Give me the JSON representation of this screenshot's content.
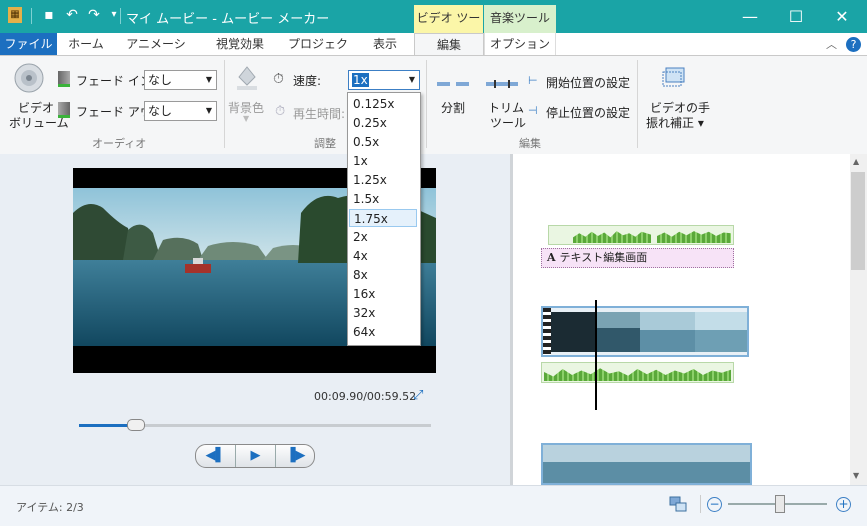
{
  "window": {
    "title": "マイ ムービー - ムービー メーカー",
    "minimize": "—",
    "maximize": "☐",
    "close": "✕"
  },
  "context_tabs": {
    "video_tools": "ビデオ ツール",
    "music_tools": "音楽ツール"
  },
  "tabs": [
    "ファイル",
    "ホーム",
    "アニメーション",
    "視覚効果",
    "プロジェクト",
    "表示",
    "編集",
    "オプション"
  ],
  "colors": {
    "titlebar": "#1aa4a6",
    "file_tab": "#1c6fc0",
    "video_tools_ctx": "#fbf6a8",
    "music_tools_ctx": "#d8f0cc",
    "text_overlay": "#f7e3f7"
  },
  "ribbon": {
    "audio": {
      "volume_label_1": "ビデオ",
      "volume_label_2": "ボリューム",
      "fade_in_label": "フェード イン:",
      "fade_in_value": "なし",
      "fade_out_label": "フェード アウト:",
      "fade_out_value": "なし",
      "group": "オーディオ"
    },
    "adjust": {
      "bg_color": "背景色",
      "speed_label": "速度:",
      "speed_value": "1x",
      "duration_label": "再生時間:",
      "group": "調整"
    },
    "edit": {
      "split": "分割",
      "trim_1": "トリム",
      "trim_2": "ツール",
      "set_start": "開始位置の設定",
      "set_end": "停止位置の設定",
      "group": "編集"
    },
    "stabilize": {
      "label_1": "ビデオの手",
      "label_2": "振れ補正 ▾"
    }
  },
  "speed_options": [
    "0.125x",
    "0.25x",
    "0.5x",
    "1x",
    "1.25x",
    "1.5x",
    "1.75x",
    "2x",
    "4x",
    "8x",
    "16x",
    "32x",
    "64x"
  ],
  "speed_highlighted": "1.75x",
  "preview": {
    "timecode": "00:09.90/00:59.52",
    "seek_fraction": 0.16
  },
  "storyboard": {
    "caption": "テキスト編集画面",
    "caption_icon": "A"
  },
  "status": {
    "items": "アイテム: 2/3",
    "zoom_fraction": 0.52
  }
}
